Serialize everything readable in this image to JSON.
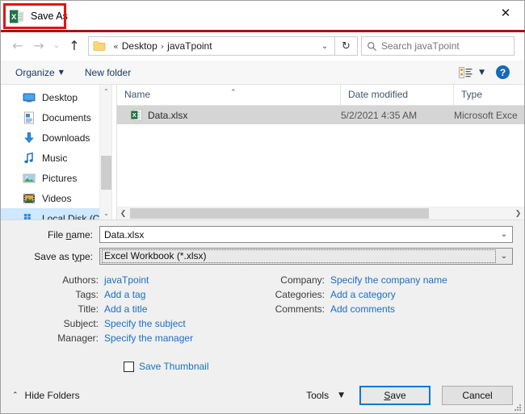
{
  "window": {
    "title": "Save As",
    "app_icon": "excel-icon",
    "close_label": "✕",
    "annotation_color": "#e8120e"
  },
  "nav": {
    "back_icon": "back-arrow-icon",
    "forward_icon": "forward-arrow-icon",
    "recent_icon": "chevron-down-icon",
    "up_icon": "up-arrow-icon",
    "folder_icon": "folder-icon",
    "separator": "«",
    "crumb_arrow": "›",
    "breadcrumbs": [
      "Desktop",
      "javaTpoint"
    ],
    "dropdown_icon": "chevron-down-icon",
    "refresh_icon": "refresh-icon",
    "refresh_glyph": "↻",
    "search_icon": "search-icon",
    "search_placeholder": "Search javaTpoint"
  },
  "toolbar": {
    "organize_label": "Organize",
    "organize_caret": "▼",
    "new_folder_label": "New folder",
    "view_icon": "view-layout-icon",
    "view_caret": "▼",
    "help_icon": "help-icon",
    "help_glyph": "?"
  },
  "sidebar": {
    "items": [
      {
        "label": "Desktop",
        "icon": "desktop-icon",
        "selected": false
      },
      {
        "label": "Documents",
        "icon": "documents-icon",
        "selected": false
      },
      {
        "label": "Downloads",
        "icon": "downloads-icon",
        "selected": false
      },
      {
        "label": "Music",
        "icon": "music-icon",
        "selected": false
      },
      {
        "label": "Pictures",
        "icon": "pictures-icon",
        "selected": false
      },
      {
        "label": "Videos",
        "icon": "videos-icon",
        "selected": false
      },
      {
        "label": "Local Disk (C:)",
        "icon": "disk-icon",
        "selected": true
      }
    ],
    "scroll_up_glyph": "⌃",
    "scroll_down_glyph": "⌄"
  },
  "filelist": {
    "sort_indicator": "⌃",
    "columns": [
      "Name",
      "Date modified",
      "Type"
    ],
    "rows": [
      {
        "name": "Data.xlsx",
        "icon": "excel-file-icon",
        "date_modified": "5/2/2021 4:35 AM",
        "type": "Microsoft Exce",
        "selected": true
      }
    ],
    "hscroll_left_glyph": "❮",
    "hscroll_right_glyph": "❯"
  },
  "form": {
    "file_name": {
      "label_pre": "File ",
      "label_acc": "n",
      "label_post": "ame:",
      "value": "Data.xlsx",
      "arrow": "⌄"
    },
    "save_as_type": {
      "label_pre": "Save as t",
      "label_acc": "y",
      "label_post": "pe:",
      "value": "Excel Workbook (*.xlsx)",
      "arrow": "⌄"
    },
    "metadata_left": [
      {
        "label": "Authors:",
        "value": "javaTpoint"
      },
      {
        "label": "Tags:",
        "value": "Add a tag"
      },
      {
        "label": "Title:",
        "value": "Add a title"
      },
      {
        "label": "Subject:",
        "value": "Specify the subject"
      },
      {
        "label": "Manager:",
        "value": "Specify the manager"
      }
    ],
    "metadata_right": [
      {
        "label": "Company:",
        "value": "Specify the company name"
      },
      {
        "label": "Categories:",
        "value": "Add a category"
      },
      {
        "label": "Comments:",
        "value": "Add comments"
      }
    ],
    "save_thumbnail": {
      "label": "Save Thumbnail",
      "checked": false
    }
  },
  "footer": {
    "hide_folders_chevron": "⌃",
    "hide_folders_label": "Hide Folders",
    "tools_label": "Tools",
    "tools_caret": "▼",
    "save_pre": "",
    "save_acc": "S",
    "save_post": "ave",
    "save_label": "Save",
    "cancel_label": "Cancel"
  }
}
